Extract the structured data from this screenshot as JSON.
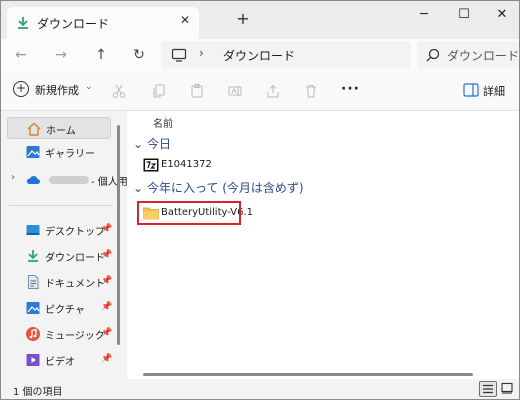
{
  "window": {
    "tab_title": "ダウンロード",
    "tab_close": "✕",
    "new_tab": "+",
    "minimize": "─",
    "maximize": "☐",
    "close": "✕"
  },
  "nav": {
    "back": "←",
    "forward": "→",
    "up": "↑",
    "refresh": "↻"
  },
  "address": {
    "separator": "›",
    "path": "ダウンロード"
  },
  "search": {
    "placeholder": "ダウンロードの"
  },
  "toolbar": {
    "new_label": "新規作成",
    "new_plus": "+",
    "new_chevron": "⌄",
    "more": "···",
    "details_label": "詳細"
  },
  "sidebar": {
    "items": [
      {
        "label": "ホーム"
      },
      {
        "label": "ギャラリー"
      },
      {
        "label": "- 個人用"
      },
      {
        "label": "デスクトップ",
        "pin": "📌"
      },
      {
        "label": "ダウンロード",
        "pin": "📌"
      },
      {
        "label": "ドキュメント",
        "pin": "📌"
      },
      {
        "label": "ピクチャ",
        "pin": "📌"
      },
      {
        "label": "ミュージック",
        "pin": "📌"
      },
      {
        "label": "ビデオ",
        "pin": "📌"
      }
    ],
    "expand": "›"
  },
  "content": {
    "column_name": "名前",
    "groups": [
      {
        "title": "今日",
        "chevron": "⌄",
        "files": [
          {
            "name": "E1041372"
          }
        ]
      },
      {
        "title": "今年に入って (今月は含めず)",
        "chevron": "⌄",
        "files": [
          {
            "name": "BatteryUtility-V6.1"
          }
        ]
      }
    ]
  },
  "status": {
    "item_count": "1 個の項目"
  },
  "colors": {
    "accent": "#2b4a8a",
    "highlight": "#d2262c",
    "folder": "#f2c14e"
  }
}
